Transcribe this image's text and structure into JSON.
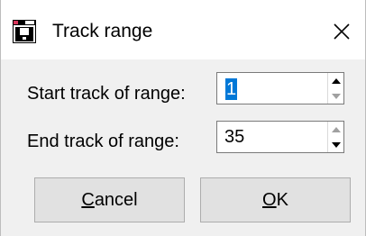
{
  "window": {
    "title": "Track range"
  },
  "icons": {
    "app": "app-window-icon",
    "close": "close-icon",
    "spin_up": "arrow-up-icon",
    "spin_down": "arrow-down-icon"
  },
  "form": {
    "start_label": "Start track of range:",
    "start_value": "1",
    "end_label": "End track of range:",
    "end_value": "35"
  },
  "buttons": {
    "cancel_first": "C",
    "cancel_rest": "ancel",
    "ok_first": "O",
    "ok_rest": "K"
  },
  "colors": {
    "selection": "#0078d7",
    "dialog_bg": "#f0f0f0",
    "button_bg": "#e1e1e1"
  }
}
